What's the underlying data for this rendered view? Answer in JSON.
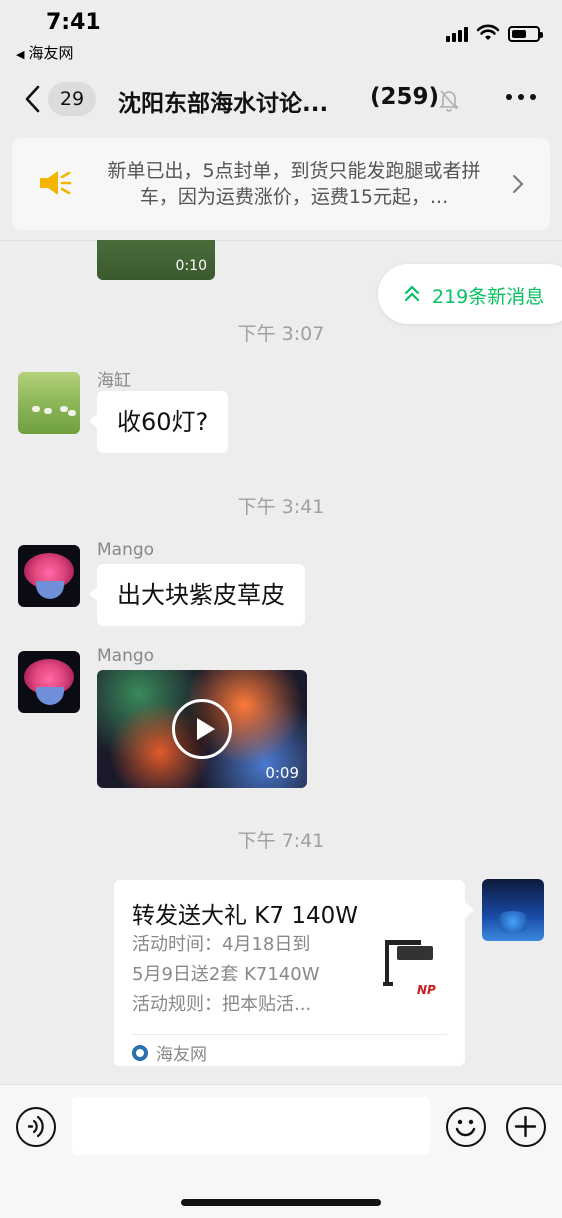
{
  "status_bar": {
    "time": "7:41",
    "back_app": "海友网"
  },
  "header": {
    "unread_count": "29",
    "title": "沈阳东部海水讨论...",
    "member_count": "(259)"
  },
  "announcement": {
    "text": "新单已出，5点封单，到货只能发跑腿或者拼车，因为运费涨价，运费15元起，..."
  },
  "messages": {
    "top_video_duration": "0:10",
    "new_messages_label": "219条新消息",
    "time_1": "下午 3:07",
    "msg_1_sender": "海缸",
    "msg_1_text": "收60灯?",
    "time_2": "下午 3:41",
    "msg_2_sender": "Mango",
    "msg_2_text": "出大块紫皮草皮",
    "msg_3_sender": "Mango",
    "msg_3_video_duration": "0:09",
    "time_3": "下午 7:41",
    "card": {
      "title": "转发送大礼 K7 140W",
      "desc_line1": "活动时间：4月18日到",
      "desc_line2": "5月9日送2套 K7140W",
      "desc_line3": "活动规则：把本贴活...",
      "source": "海友网",
      "thumb_text": "NP"
    }
  },
  "input_bar": {
    "placeholder": ""
  },
  "colors": {
    "accent_green": "#07c160",
    "announce_icon": "#f5b400",
    "background": "#ededed"
  }
}
